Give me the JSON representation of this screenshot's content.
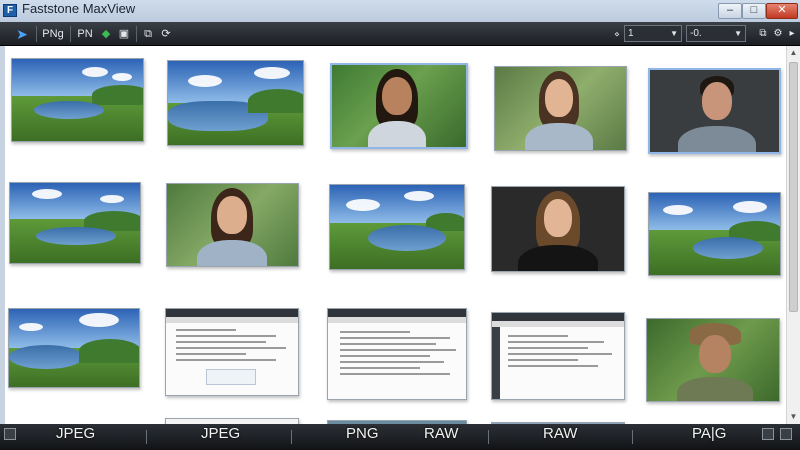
{
  "window": {
    "title": "Faststone MaxView",
    "minimize": "–",
    "maximize": "□",
    "close": "✕"
  },
  "toolbar": {
    "open_icon": "pointer-icon",
    "format_label": "PNg",
    "format2_label": "PN",
    "dropdown1": {
      "value": "1"
    },
    "dropdown2": {
      "value": "-0."
    }
  },
  "thumbnails": [
    {
      "kind": "landscape"
    },
    {
      "kind": "landscape"
    },
    {
      "kind": "portrait-woman"
    },
    {
      "kind": "portrait-woman"
    },
    {
      "kind": "portrait-man"
    },
    {
      "kind": "landscape"
    },
    {
      "kind": "portrait-woman"
    },
    {
      "kind": "landscape"
    },
    {
      "kind": "portrait-woman"
    },
    {
      "kind": "landscape"
    },
    {
      "kind": "landscape"
    },
    {
      "kind": "document"
    },
    {
      "kind": "document"
    },
    {
      "kind": "document"
    },
    {
      "kind": "portrait-man-hat"
    }
  ],
  "bottom_labels": [
    "JPEG",
    "JPEG",
    "PNG",
    "RAW",
    "RAW",
    "PA|G"
  ]
}
